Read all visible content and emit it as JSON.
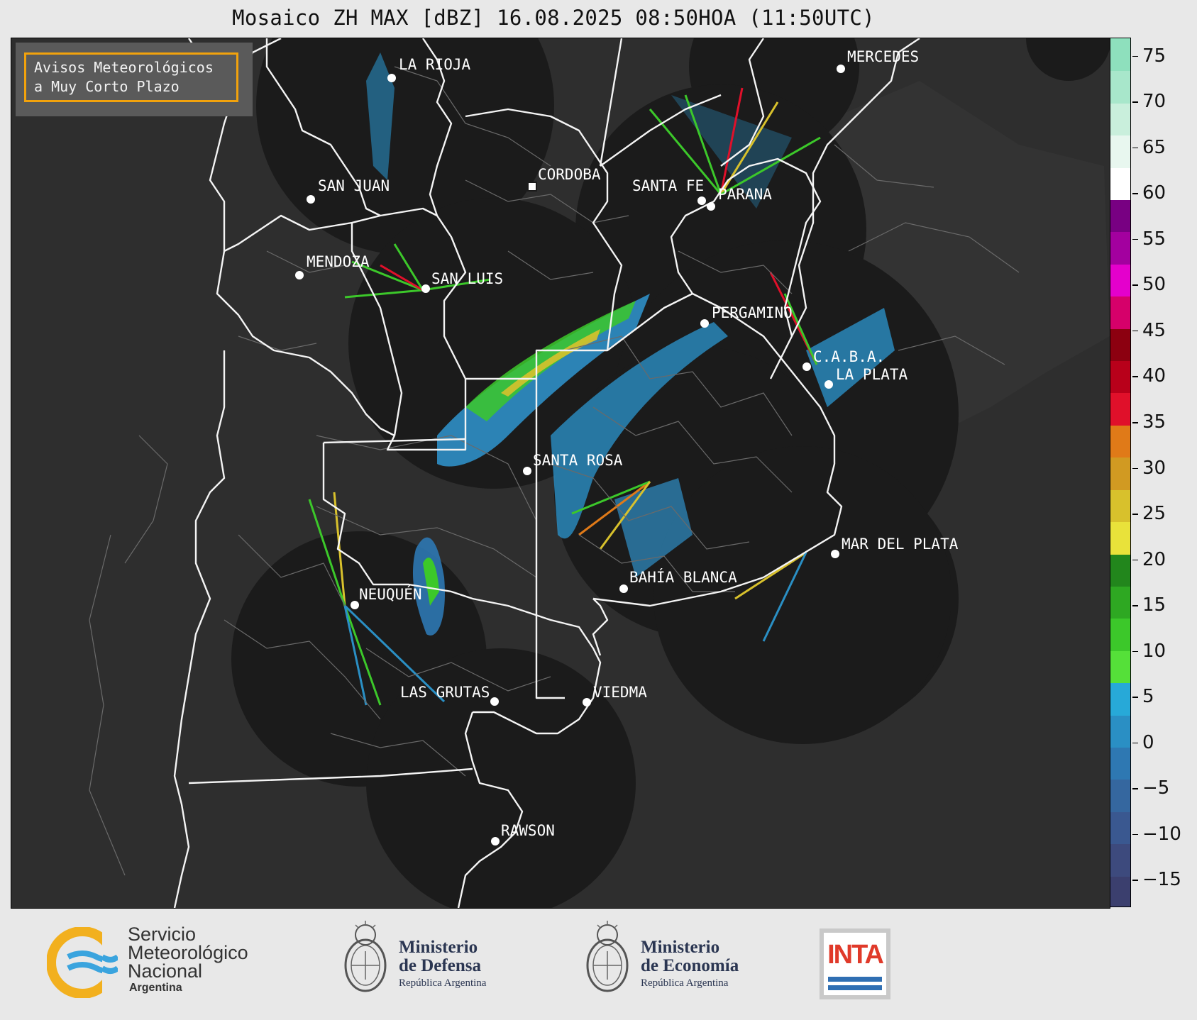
{
  "title": "Mosaico ZH MAX [dBZ] 16.08.2025 08:50HOA (11:50UTC)",
  "notice": {
    "line1": "Avisos Meteorológicos",
    "line2": "a Muy Corto Plazo"
  },
  "cities": [
    {
      "name": "LA RIOJA"
    },
    {
      "name": "MERCEDES"
    },
    {
      "name": "CORDOBA"
    },
    {
      "name": "SAN JUAN"
    },
    {
      "name": "SANTA FE"
    },
    {
      "name": "PARANA"
    },
    {
      "name": "MENDOZA"
    },
    {
      "name": "SAN LUIS"
    },
    {
      "name": "PERGAMINO"
    },
    {
      "name": "C.A.B.A."
    },
    {
      "name": "LA PLATA"
    },
    {
      "name": "SANTA ROSA"
    },
    {
      "name": "MAR DEL PLATA"
    },
    {
      "name": "BAHÍA BLANCA"
    },
    {
      "name": "NEUQUÉN"
    },
    {
      "name": "LAS GRUTAS"
    },
    {
      "name": "VIEDMA"
    },
    {
      "name": "RAWSON"
    }
  ],
  "colorbar": {
    "ticks": [
      "75",
      "70",
      "65",
      "60",
      "55",
      "50",
      "45",
      "40",
      "35",
      "30",
      "25",
      "20",
      "15",
      "10",
      "5",
      "0",
      "−5",
      "−10",
      "−15"
    ],
    "colors": [
      "#3b3f6e",
      "#3d4a7d",
      "#3a5890",
      "#35679f",
      "#2e78b2",
      "#2a8fc4",
      "#27a9d8",
      "#55e039",
      "#3cc82a",
      "#2ea822",
      "#22861c",
      "#e9e23a",
      "#d8c12c",
      "#d19a22",
      "#e07a18",
      "#e0102a",
      "#b8001a",
      "#8c0010",
      "#d6006a",
      "#e400cc",
      "#a3009f",
      "#780082",
      "#ffffff",
      "#e8f7ef",
      "#c9efdc",
      "#a8e7cb",
      "#8ee0bd"
    ],
    "range": [
      -18,
      77
    ]
  },
  "footer": {
    "smn": {
      "line1": "Servicio",
      "line2": "Meteorológico",
      "line3": "Nacional",
      "line4": "Argentina"
    },
    "defensa": {
      "line1": "Ministerio",
      "line2": "de Defensa",
      "line3": "República Argentina"
    },
    "economia": {
      "line1": "Ministerio",
      "line2": "de Economía",
      "line3": "República Argentina"
    },
    "inta": {
      "label": "INTA"
    }
  }
}
